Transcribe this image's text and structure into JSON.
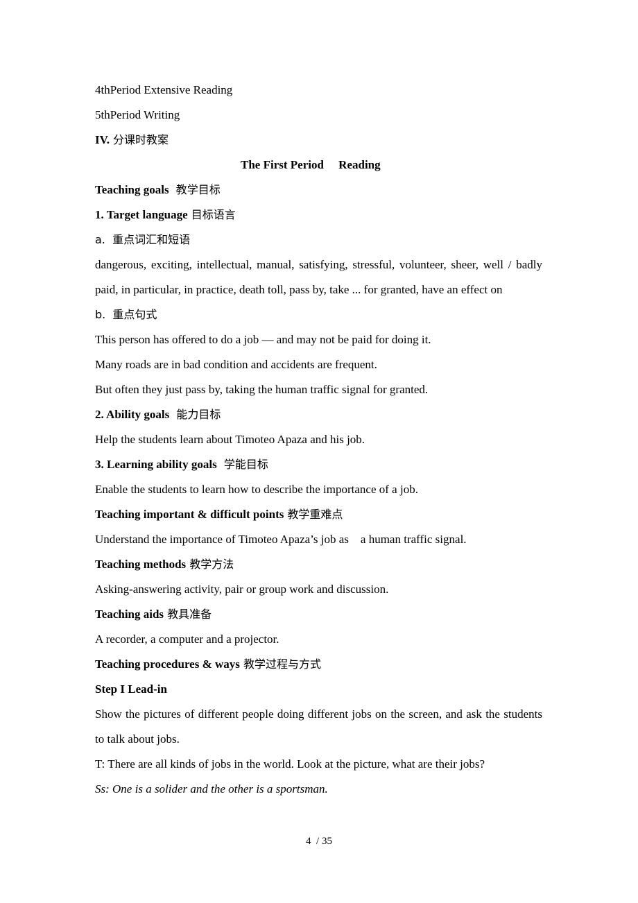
{
  "document": {
    "page_footer": "4  / 35",
    "lines": [
      {
        "key": "l0",
        "type": "line",
        "text": "4thPeriod Extensive Reading"
      },
      {
        "key": "l1",
        "type": "line",
        "text": "5thPeriod Writing"
      },
      {
        "key": "l2",
        "type": "mixed",
        "en": "IV.",
        "cn": " 分课时教案"
      },
      {
        "key": "l3",
        "type": "title",
        "text": "The First Period     Reading"
      },
      {
        "key": "l4",
        "type": "mixed",
        "en": "Teaching goals",
        "cn": "  教学目标"
      },
      {
        "key": "l5",
        "type": "mixed",
        "en": "1. Target language",
        "cn": " 目标语言"
      },
      {
        "key": "l6",
        "type": "cnline",
        "text": "a.  重点词汇和短语"
      },
      {
        "key": "l7",
        "type": "para",
        "text": "dangerous, exciting, intellectual, manual, satisfying, stressful, volunteer, sheer, well / badly paid, in particular, in practice, death toll, pass by, take ... for granted, have an effect on"
      },
      {
        "key": "l8",
        "type": "cnline",
        "text": "b.  重点句式"
      },
      {
        "key": "l9",
        "type": "line",
        "text": "This person has offered to do a job — and may not be paid for doing it."
      },
      {
        "key": "l10",
        "type": "line",
        "text": "Many roads are in bad condition and accidents are frequent."
      },
      {
        "key": "l11",
        "type": "line",
        "text": "But often they just pass by, taking the human traffic signal for granted."
      },
      {
        "key": "l12",
        "type": "mixed",
        "en": "2. Ability goals",
        "cn": "  能力目标"
      },
      {
        "key": "l13",
        "type": "line",
        "text": "Help the students learn about Timoteo Apaza and his job."
      },
      {
        "key": "l14",
        "type": "mixed",
        "en": "3. Learning ability goals",
        "cn": "  学能目标"
      },
      {
        "key": "l15",
        "type": "line",
        "text": "Enable the students to learn how to describe the importance of a job."
      },
      {
        "key": "l16",
        "type": "mixed",
        "en": "Teaching important & difficult points",
        "cn": " 教学重难点"
      },
      {
        "key": "l17",
        "type": "line",
        "text": "Understand the importance of Timoteo Apaza’s job as    a human traffic signal."
      },
      {
        "key": "l18",
        "type": "mixed",
        "en": "Teaching methods",
        "cn": " 教学方法"
      },
      {
        "key": "l19",
        "type": "line",
        "text": "Asking-answering activity, pair or group work and discussion."
      },
      {
        "key": "l20",
        "type": "mixed",
        "en": "Teaching aids",
        "cn": " 教具准备"
      },
      {
        "key": "l21",
        "type": "line",
        "text": "A recorder, a computer and a projector."
      },
      {
        "key": "l22",
        "type": "mixed",
        "en": "Teaching procedures & ways",
        "cn": " 教学过程与方式"
      },
      {
        "key": "l23",
        "type": "bold",
        "text": "Step I Lead-in"
      },
      {
        "key": "l24",
        "type": "para",
        "text": "Show the pictures of different people doing different jobs on the screen, and ask the students to talk about jobs."
      },
      {
        "key": "l25",
        "type": "line",
        "text": "T: There are all kinds of jobs in the world. Look at the picture, what are their jobs?"
      },
      {
        "key": "l26",
        "type": "italic",
        "text": "Ss: One is a solider and the other is a sportsman."
      }
    ]
  }
}
